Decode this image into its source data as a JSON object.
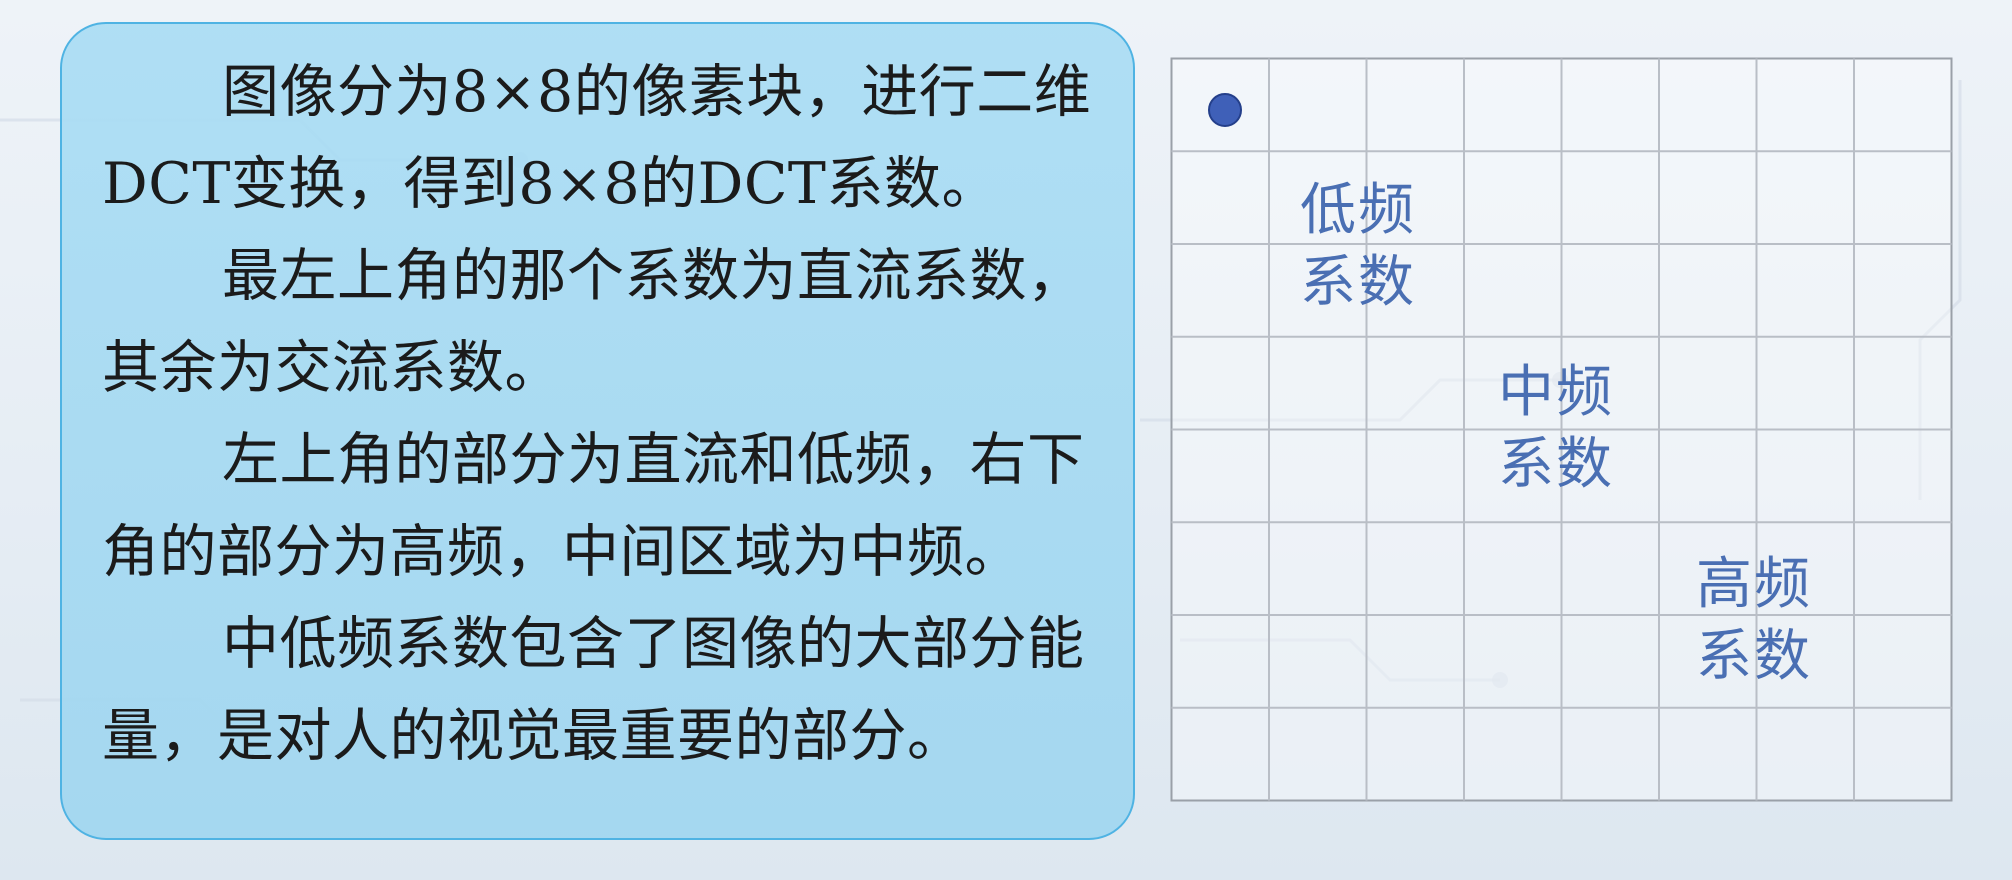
{
  "paragraphs": [
    "图像分为8×8的像素块，进行二维DCT变换，得到8×8的DCT系数。",
    "最左上角的那个系数为直流系数，其余为交流系数。",
    "左上角的部分为直流和低频，右下角的部分为高频，中间区域为中频。",
    "中低频系数包含了图像的大部分能量，是对人的视觉最重要的部分。"
  ],
  "grid": {
    "rows": 8,
    "cols": 8
  },
  "regions": {
    "low": {
      "line1": "低频",
      "line2": "系数"
    },
    "mid": {
      "line1": "中频",
      "line2": "系数"
    },
    "high": {
      "line1": "高频",
      "line2": "系数"
    }
  },
  "colors": {
    "panel_fill": "#a8dcf3",
    "panel_border": "#4fb3e3",
    "label_text": "#4a6fb3",
    "grid_line": "#b9bec6",
    "dc_dot": "#3f60b8"
  }
}
